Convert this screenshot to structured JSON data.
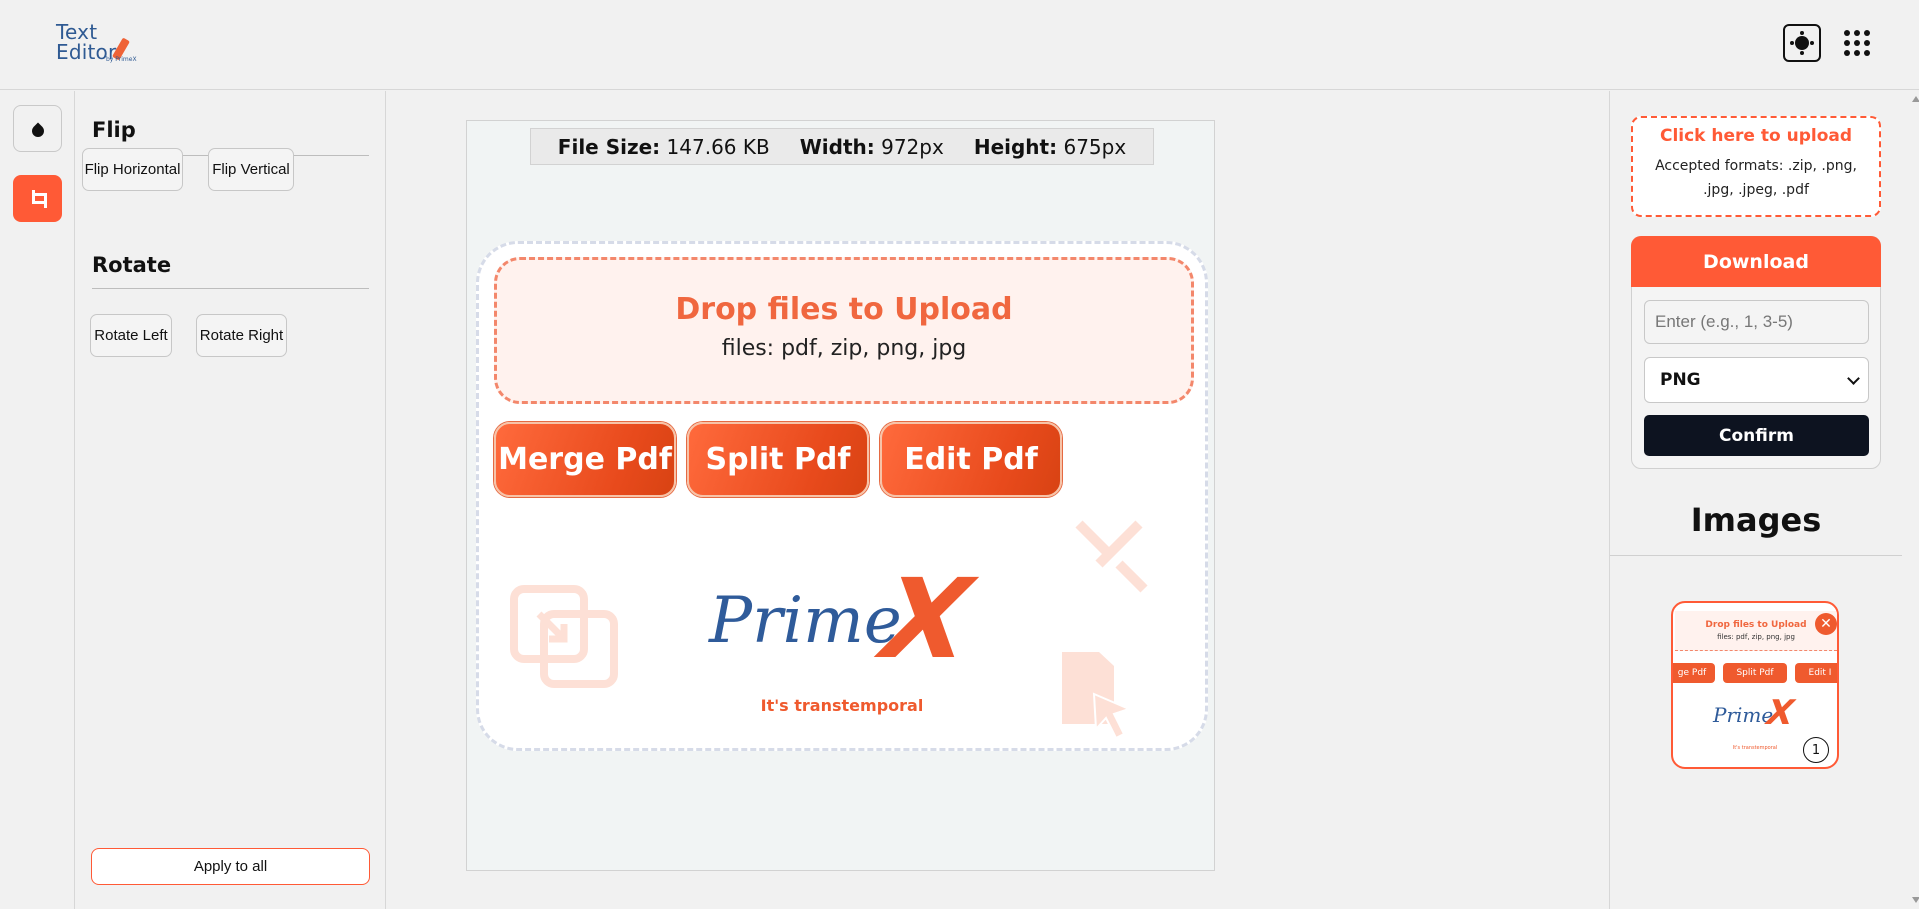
{
  "app": {
    "logo_line1": "Text",
    "logo_line2": "Editor",
    "logo_by": "by PrimeX"
  },
  "header": {
    "theme_icon": "sun-icon",
    "apps_icon": "grid-dots-icon"
  },
  "rail": {
    "items": [
      {
        "icon": "droplet-icon",
        "active": false
      },
      {
        "icon": "crop-icon",
        "active": true
      }
    ]
  },
  "options": {
    "flip_title": "Flip",
    "flip_horizontal": "Flip Horizontal",
    "flip_vertical": "Flip Vertical",
    "rotate_title": "Rotate",
    "rotate_left": "Rotate Left",
    "rotate_right": "Rotate Right",
    "apply_all": "Apply to all"
  },
  "file_info": {
    "size_label": "File Size:",
    "size_value": "147.66 KB",
    "width_label": "Width:",
    "width_value": "972px",
    "height_label": "Height:",
    "height_value": "675px"
  },
  "preview": {
    "drop_title": "Drop files to Upload",
    "drop_sub": "files: pdf, zip, png, jpg",
    "buttons": [
      "Merge Pdf",
      "Split Pdf",
      "Edit Pdf"
    ],
    "brand": "Prime",
    "brand_x": "X",
    "tagline": "It's transtemporal"
  },
  "right": {
    "upload_title": "Click here to upload",
    "upload_formats": "Accepted formats: .zip, .png, .jpg, .jpeg, .pdf",
    "download_label": "Download",
    "range_placeholder": "Enter (e.g., 1, 3-5)",
    "format_value": "PNG",
    "confirm_label": "Confirm",
    "images_title": "Images"
  },
  "thumbnail": {
    "drop_title": "Drop files to Upload",
    "drop_sub": "files: pdf, zip, png, jpg",
    "buttons": [
      "ge Pdf",
      "Split Pdf",
      "Edit I"
    ],
    "brand": "Prime",
    "brand_x": "X",
    "tagline": "It's transtemporal",
    "close": "✕",
    "number": "1"
  },
  "colors": {
    "accent": "#ff5a36",
    "dark_button": "#0d1320",
    "brand_blue": "#2f5b9a"
  }
}
